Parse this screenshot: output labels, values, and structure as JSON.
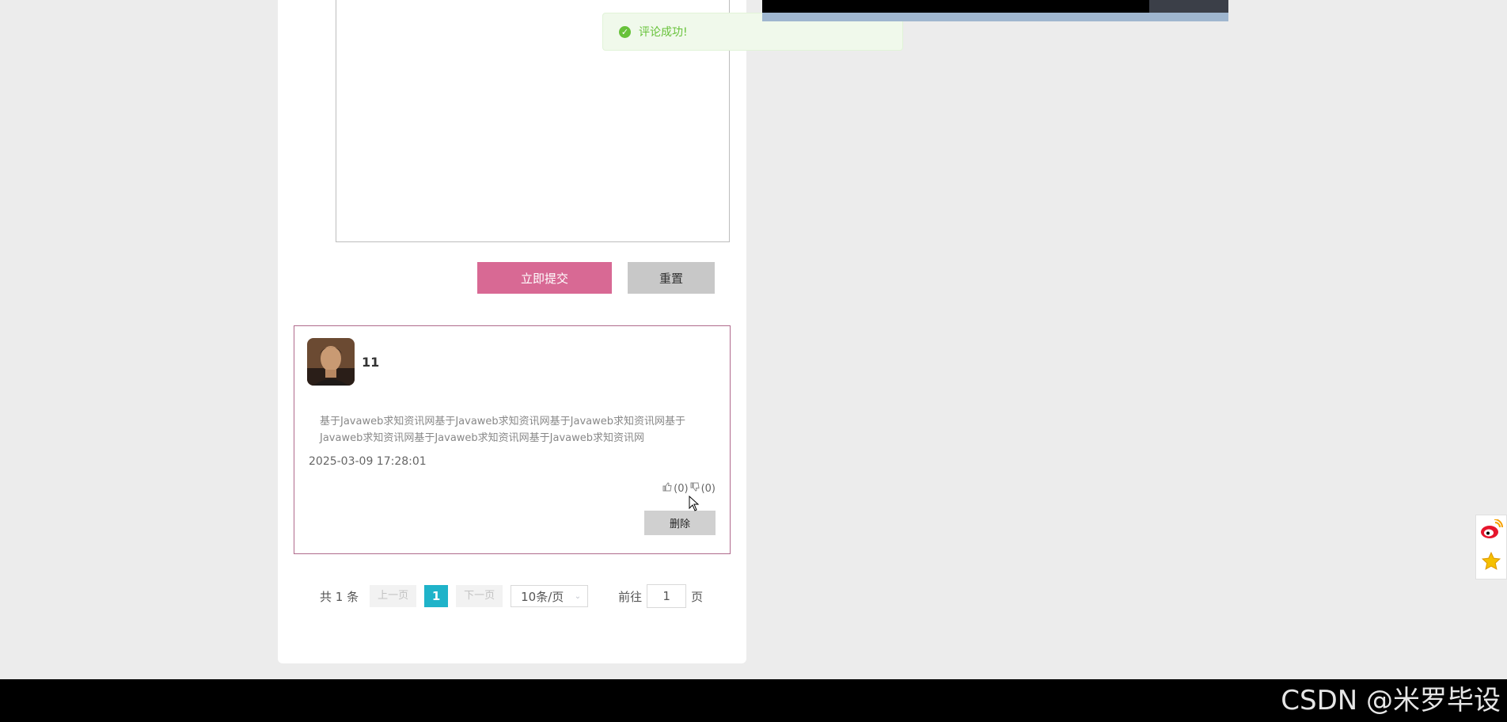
{
  "toast": {
    "message": "评论成功!"
  },
  "form": {
    "submit_label": "立即提交",
    "reset_label": "重置"
  },
  "comment": {
    "username": "11",
    "content": "基于Javaweb求知资讯网基于Javaweb求知资讯网基于Javaweb求知资讯网基于Javaweb求知资讯网基于Javaweb求知资讯网基于Javaweb求知资讯网",
    "time": "2025-03-09 17:28:01",
    "likes": "(0)",
    "dislikes": "(0)",
    "delete_label": "删除"
  },
  "pagination": {
    "total": "共 1 条",
    "prev": "上一页",
    "current": "1",
    "next": "下一页",
    "page_size": "10条/页",
    "goto_label": "前往",
    "goto_value": "1",
    "page_suffix": "页"
  },
  "watermark": "CSDN @米罗毕设",
  "colors": {
    "submit": "#d86994",
    "reset": "#c8c8c8",
    "current_page": "#1fb3c9",
    "toast_text": "#67c23a",
    "comment_border": "#b06a8c"
  },
  "icons": [
    "check-circle-icon",
    "thumbs-up-icon",
    "thumbs-down-icon",
    "chevron-down-icon",
    "weibo-icon",
    "star-icon",
    "cursor-icon"
  ]
}
